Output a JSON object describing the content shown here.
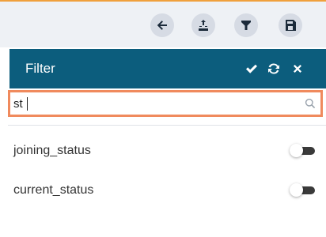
{
  "colors": {
    "accent": "#f0a03c",
    "header_bg": "#0c5d7d",
    "search_border": "#f08a5d",
    "toolbar_bg": "#eef1f5"
  },
  "toolbar": {
    "buttons": [
      {
        "name": "back",
        "icon": "arrow-left-icon"
      },
      {
        "name": "export",
        "icon": "export-icon"
      },
      {
        "name": "filter",
        "icon": "funnel-icon"
      },
      {
        "name": "save",
        "icon": "floppy-disk-icon"
      }
    ]
  },
  "filter_panel": {
    "title": "Filter",
    "header_actions": [
      "check-icon",
      "refresh-icon",
      "close-icon"
    ],
    "search": {
      "value": "st",
      "placeholder": ""
    },
    "items": [
      {
        "label": "joining_status",
        "enabled": false
      },
      {
        "label": "current_status",
        "enabled": false
      }
    ]
  }
}
